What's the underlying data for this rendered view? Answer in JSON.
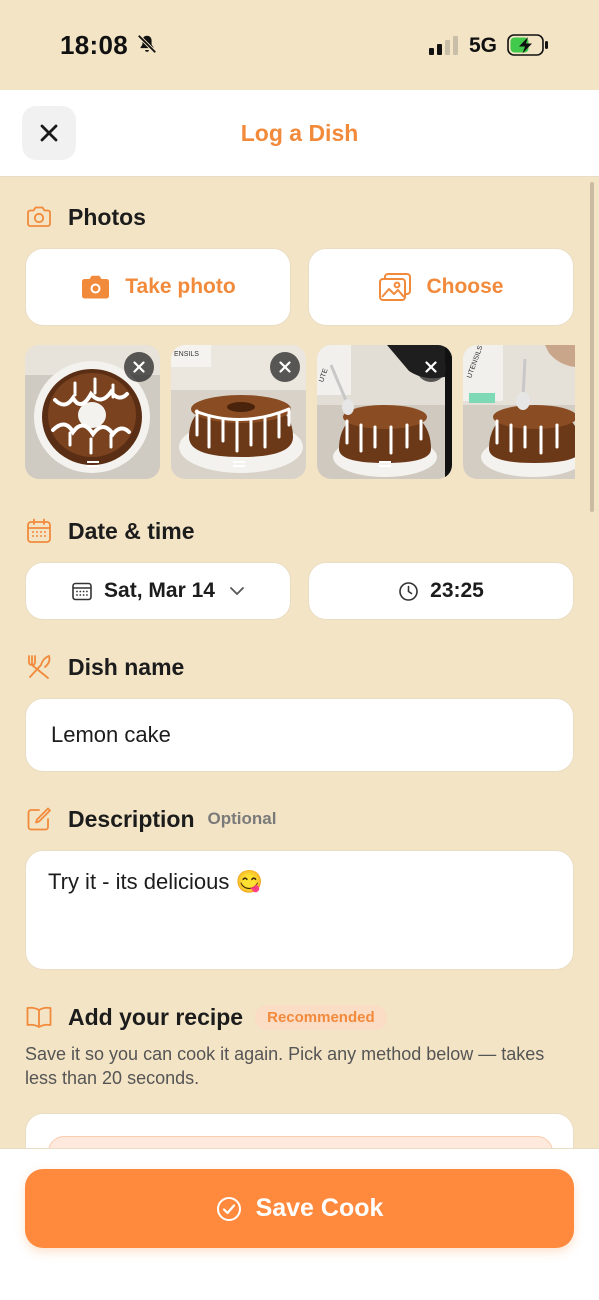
{
  "status_bar": {
    "time": "18:08",
    "network": "5G",
    "silent_mode_icon": "bell-slash-icon",
    "battery_state": "charging"
  },
  "header": {
    "title": "Log a Dish",
    "close_icon": "close-icon"
  },
  "photos": {
    "title": "Photos",
    "take_photo_label": "Take photo",
    "choose_label": "Choose",
    "thumbnails": [
      {
        "subject": "cake-top-view"
      },
      {
        "subject": "cake-side-view"
      },
      {
        "subject": "cake-glaze-pour",
        "text": "UTE"
      },
      {
        "subject": "cake-glaze-pour-2",
        "text": "UTENSILS"
      }
    ],
    "partial_text": "ENSILS"
  },
  "date_time": {
    "title": "Date & time",
    "date": "Sat, Mar 14",
    "time": "23:25"
  },
  "dish_name": {
    "title": "Dish name",
    "value": "Lemon cake"
  },
  "description": {
    "title": "Description",
    "optional_label": "Optional",
    "value": "Try it - its delicious 😋"
  },
  "recipe": {
    "title": "Add your recipe",
    "badge": "Recommended",
    "help_text": "Save it so you can cook it again. Pick any method below — takes less than 20 seconds."
  },
  "footer": {
    "save_label": "Save Cook"
  },
  "colors": {
    "accent": "#F28A3C",
    "background": "#F3E4C5",
    "save_button": "#FF8A3D"
  }
}
